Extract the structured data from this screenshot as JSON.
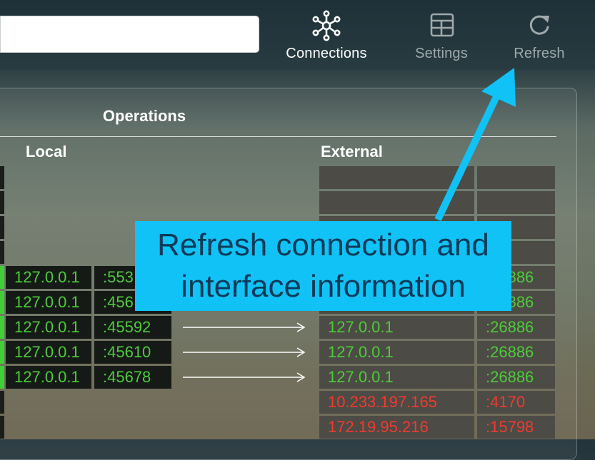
{
  "toolbar": {
    "connections_label": "Connections",
    "settings_label": "Settings",
    "refresh_label": "Refresh"
  },
  "panel": {
    "title": "Operations",
    "local_header": "Local",
    "external_header": "External"
  },
  "rows": [
    {
      "local_ip": "",
      "local_port": "",
      "ext_ip": "",
      "ext_port": "",
      "edge": "dark"
    },
    {
      "local_ip": "",
      "local_port": "",
      "ext_ip": "",
      "ext_port": "",
      "edge": "dark"
    },
    {
      "local_ip": "",
      "local_port": "",
      "ext_ip": "",
      "ext_port": "",
      "edge": "dark"
    },
    {
      "local_ip": "",
      "local_port": "",
      "ext_ip": "",
      "ext_port": "",
      "edge": "dark"
    },
    {
      "local_ip": "127.0.0.1",
      "local_port": ":553",
      "ext_ip": "",
      "ext_port": ":26886",
      "edge": "green"
    },
    {
      "local_ip": "127.0.0.1",
      "local_port": ":456",
      "ext_ip": "",
      "ext_port": ":26886",
      "edge": "green"
    },
    {
      "local_ip": "127.0.0.1",
      "local_port": ":45592",
      "ext_ip": "127.0.0.1",
      "ext_port": ":26886",
      "edge": "green"
    },
    {
      "local_ip": "127.0.0.1",
      "local_port": ":45610",
      "ext_ip": "127.0.0.1",
      "ext_port": ":26886",
      "edge": "green"
    },
    {
      "local_ip": "127.0.0.1",
      "local_port": ":45678",
      "ext_ip": "127.0.0.1",
      "ext_port": ":26886",
      "edge": "green"
    },
    {
      "local_ip": "",
      "local_port": "",
      "ext_ip": "10.233.197.165",
      "ext_port": ":4170",
      "edge": "dark"
    },
    {
      "local_ip": "",
      "local_port": "",
      "ext_ip": "172.19.95.216",
      "ext_port": ":15798",
      "edge": "dark"
    }
  ],
  "callout": {
    "line1": "Refresh connection and",
    "line2": "interface information"
  },
  "colors": {
    "callout_bg": "#10c2f5",
    "callout_text": "#0b3a59",
    "ok_green": "#4ccc3a",
    "remote_red": "#f23a2f"
  }
}
